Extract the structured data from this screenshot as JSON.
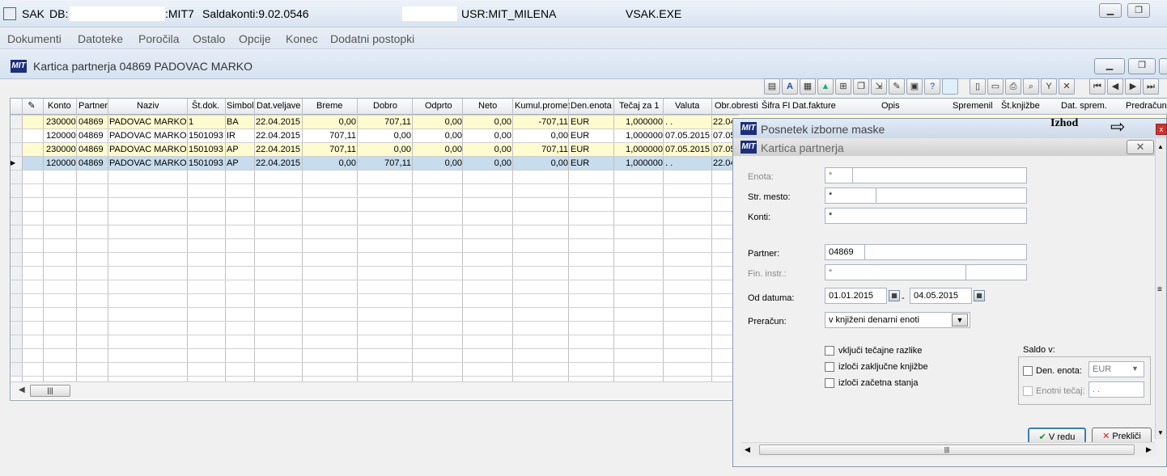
{
  "title_bar": {
    "app": "SAK",
    "db_label": "DB:",
    "db_suffix": ":MIT7",
    "saldakonti": "Saldakonti:9.02.0546",
    "user": "USR:MIT_MILENA",
    "exe": "VSAK.EXE"
  },
  "menu": [
    "Dokumenti",
    "Datoteke",
    "Poročila",
    "Ostalo",
    "Opcije",
    "Konec",
    "Dodatni postopki"
  ],
  "inner_window": {
    "title": "Kartica partnerja 04869 PADOVAC MARKO",
    "logo": "MIT"
  },
  "grid": {
    "headers": [
      "Konto",
      "Partner",
      "Naziv",
      "Št.dok.",
      "Simbol",
      "Dat.veljave",
      "Breme",
      "Dobro",
      "Odprto",
      "Neto",
      "Kumul.promet",
      "Den.enota",
      "Tečaj za 1",
      "Valuta",
      "Obr.obresti",
      "Šifra FI",
      "Dat.fakture",
      "Opis",
      "Spremenil",
      "Št.knjižbe",
      "Dat. sprem.",
      "Predračun"
    ],
    "rows": [
      [
        "230000",
        "04869",
        "PADOVAC MARKO",
        "1",
        "BA",
        "22.04.2015",
        "0,00",
        "707,11",
        "0,00",
        "0,00",
        "-707,11",
        "EUR",
        "1,000000",
        ". .",
        "22.04"
      ],
      [
        "120000",
        "04869",
        "PADOVAC MARKO",
        "1501093",
        "IR",
        "22.04.2015",
        "707,11",
        "0,00",
        "0,00",
        "0,00",
        "0,00",
        "EUR",
        "1,000000",
        "07.05.2015",
        "07.05"
      ],
      [
        "230000",
        "04869",
        "PADOVAC MARKO",
        "1501093",
        "AP",
        "22.04.2015",
        "707,11",
        "0,00",
        "0,00",
        "0,00",
        "707,11",
        "EUR",
        "1,000000",
        "07.05.2015",
        "07.05"
      ],
      [
        "120000",
        "04869",
        "PADOVAC MARKO",
        "1501093",
        "AP",
        "22.04.2015",
        "0,00",
        "707,11",
        "0,00",
        "0,00",
        "0,00",
        "EUR",
        "1,000000",
        ". .",
        "22.04"
      ]
    ],
    "row_colors": [
      "#fffbd0",
      "#ffffff",
      "#fffbd0",
      "#c7dcec"
    ]
  },
  "dialog": {
    "outer_title": "Posnetek izborne maske",
    "annotation": "Izhod",
    "title": "Kartica partnerja",
    "enota_label": "Enota:",
    "enota_value": "*",
    "strmesto_label": "Str. mesto:",
    "strmesto_value": "*",
    "konti_label": "Konti:",
    "konti_value": "*",
    "partner_label": "Partner:",
    "partner_value": "04869",
    "fininstr_label": "Fin. instr.:",
    "fininstr_value": "*",
    "oddatuma_label": "Od datuma:",
    "date_from": "01.01.2015",
    "date_sep": "-",
    "date_to": "04.05.2015",
    "preracun_label": "Preračun:",
    "preracun_value": "v knjiženi denarni enoti",
    "cb1": "vključi tečajne razlike",
    "cb2": "izloči zaključne knjižbe",
    "cb3": "izloči začetna stanja",
    "saldo_label": "Saldo v:",
    "den_enota_label": "Den. enota:",
    "den_enota_value": "EUR",
    "enotni_tecaj_label": "Enotni tečaj:",
    "enotni_tecaj_value": ". .",
    "ok_label": "V redu",
    "cancel_label": "Prekliči"
  }
}
